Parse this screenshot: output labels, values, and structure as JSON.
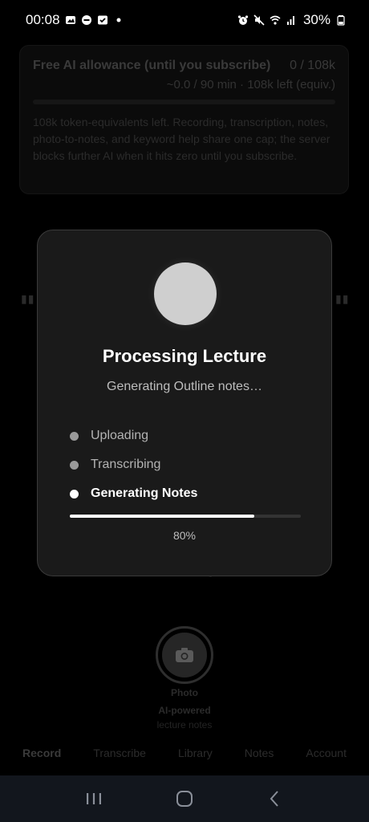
{
  "status_bar": {
    "time": "00:08",
    "battery": "30%",
    "left_icons": [
      "image-icon",
      "do-not-disturb-icon",
      "task-check-icon",
      "dot-icon"
    ],
    "right_icons": [
      "alarm-icon",
      "mute-icon",
      "wifi-icon",
      "signal-icon",
      "battery-icon"
    ]
  },
  "allowance": {
    "title": "Free AI allowance (until you subscribe)",
    "count": "0 / 108k",
    "sub": "~0.0 / 90 min · 108k left (equiv.)",
    "description": "108k token-equivalents left. Recording, transcription, notes, photo-to-notes, and keyword help share one cap; the server blocks further AI when it hits zero until you subscribe."
  },
  "background": {
    "photo_label": "Photo",
    "ai_label": "AI-powered",
    "lecture_label": "lecture notes",
    "partial_text": "g"
  },
  "bottom_tabs": [
    {
      "label": "Record",
      "active": true
    },
    {
      "label": "Transcribe",
      "active": false
    },
    {
      "label": "Library",
      "active": false
    },
    {
      "label": "Notes",
      "active": false
    },
    {
      "label": "Account",
      "active": false
    }
  ],
  "modal": {
    "title": "Processing Lecture",
    "subtitle": "Generating Outline notes…",
    "steps": [
      {
        "label": "Uploading",
        "state": "done"
      },
      {
        "label": "Transcribing",
        "state": "done"
      },
      {
        "label": "Generating Notes",
        "state": "active"
      }
    ],
    "progress": 0.8,
    "progress_label": "80%"
  },
  "system_nav": [
    "recent-apps-icon",
    "home-icon",
    "back-icon"
  ]
}
